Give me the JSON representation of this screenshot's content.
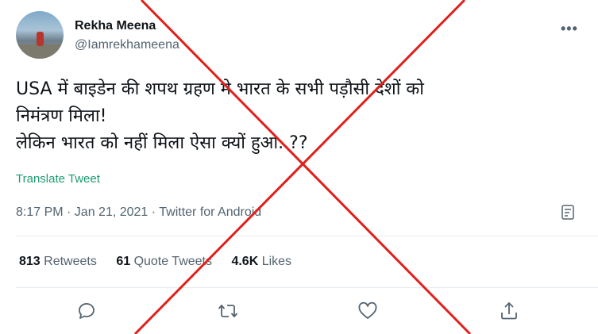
{
  "user": {
    "display_name": "Rekha Meena",
    "handle": "@Iamrekhameena"
  },
  "tweet": {
    "lines": [
      "USA में बाइडेन की शपथ ग्रहण मे भारत के सभी पड़ौसी देशों को",
      "निमंत्रण मिला!",
      "लेकिन भारत को नहीं मिला ऐसा क्यों हुआ..??"
    ],
    "translate_label": "Translate Tweet",
    "timestamp": "8:17 PM · Jan 21, 2021 · Twitter for Android"
  },
  "stats": {
    "retweets_count": "813",
    "retweets_label": "Retweets",
    "quotes_count": "61",
    "quotes_label": "Quote Tweets",
    "likes_count": "4.6K",
    "likes_label": "Likes"
  },
  "menu": {
    "more_label": "•••"
  },
  "icons": [
    "reply-icon",
    "retweet-icon",
    "like-icon",
    "share-icon",
    "analytics-icon"
  ],
  "colors": {
    "text": "#0f1419",
    "secondary": "#536471",
    "translate": "#1d9b70",
    "cross_mark": "#e0201c"
  }
}
